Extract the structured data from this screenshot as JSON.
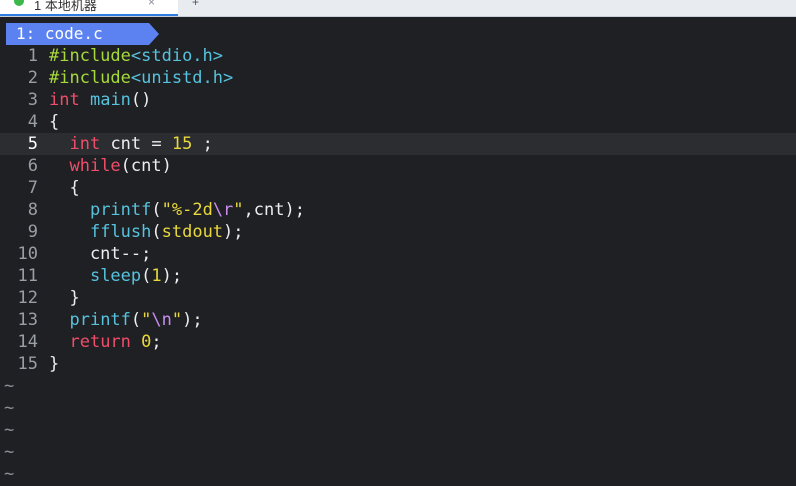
{
  "tab": {
    "label": "1 本地机器",
    "close": "×",
    "add": "+"
  },
  "buffer": {
    "label": "1: code.c"
  },
  "editor": {
    "current_line": 5,
    "lines": [
      {
        "n": "1",
        "tokens": [
          {
            "c": "pre",
            "t": "#include"
          },
          {
            "c": "inc",
            "t": "<stdio.h>"
          }
        ]
      },
      {
        "n": "2",
        "tokens": [
          {
            "c": "pre",
            "t": "#include"
          },
          {
            "c": "inc",
            "t": "<unistd.h>"
          }
        ]
      },
      {
        "n": "3",
        "tokens": [
          {
            "c": "kw",
            "t": "int"
          },
          {
            "c": "plain",
            "t": " "
          },
          {
            "c": "fn",
            "t": "main"
          },
          {
            "c": "plain",
            "t": "()"
          }
        ]
      },
      {
        "n": "4",
        "tokens": [
          {
            "c": "plain",
            "t": "{"
          }
        ]
      },
      {
        "n": "5",
        "tokens": [
          {
            "c": "plain",
            "t": "  "
          },
          {
            "c": "kw",
            "t": "int"
          },
          {
            "c": "plain",
            "t": " cnt = "
          },
          {
            "c": "num",
            "t": "15"
          },
          {
            "c": "plain",
            "t": " ;"
          }
        ]
      },
      {
        "n": "6",
        "tokens": [
          {
            "c": "plain",
            "t": "  "
          },
          {
            "c": "kw",
            "t": "while"
          },
          {
            "c": "plain",
            "t": "(cnt)"
          }
        ]
      },
      {
        "n": "7",
        "tokens": [
          {
            "c": "plain",
            "t": "  {"
          }
        ]
      },
      {
        "n": "8",
        "tokens": [
          {
            "c": "plain",
            "t": "    "
          },
          {
            "c": "fn",
            "t": "printf"
          },
          {
            "c": "plain",
            "t": "("
          },
          {
            "c": "str",
            "t": "\"%-2d"
          },
          {
            "c": "esc",
            "t": "\\r"
          },
          {
            "c": "str",
            "t": "\""
          },
          {
            "c": "plain",
            "t": ",cnt);"
          }
        ]
      },
      {
        "n": "9",
        "tokens": [
          {
            "c": "plain",
            "t": "    "
          },
          {
            "c": "fn",
            "t": "fflush"
          },
          {
            "c": "plain",
            "t": "("
          },
          {
            "c": "num",
            "t": "stdout"
          },
          {
            "c": "plain",
            "t": ");"
          }
        ]
      },
      {
        "n": "10",
        "tokens": [
          {
            "c": "plain",
            "t": "    cnt--;"
          }
        ]
      },
      {
        "n": "11",
        "tokens": [
          {
            "c": "plain",
            "t": "    "
          },
          {
            "c": "fn",
            "t": "sleep"
          },
          {
            "c": "plain",
            "t": "("
          },
          {
            "c": "num",
            "t": "1"
          },
          {
            "c": "plain",
            "t": ");"
          }
        ]
      },
      {
        "n": "12",
        "tokens": [
          {
            "c": "plain",
            "t": "  }"
          }
        ]
      },
      {
        "n": "13",
        "tokens": [
          {
            "c": "plain",
            "t": "  "
          },
          {
            "c": "fn",
            "t": "printf"
          },
          {
            "c": "plain",
            "t": "("
          },
          {
            "c": "str",
            "t": "\""
          },
          {
            "c": "esc",
            "t": "\\n"
          },
          {
            "c": "str",
            "t": "\""
          },
          {
            "c": "plain",
            "t": ");"
          }
        ]
      },
      {
        "n": "14",
        "tokens": [
          {
            "c": "plain",
            "t": "  "
          },
          {
            "c": "kw",
            "t": "return"
          },
          {
            "c": "plain",
            "t": " "
          },
          {
            "c": "num",
            "t": "0"
          },
          {
            "c": "plain",
            "t": ";"
          }
        ]
      },
      {
        "n": "15",
        "tokens": [
          {
            "c": "plain",
            "t": "}"
          }
        ]
      }
    ],
    "tilde_lines": [
      "~",
      "~",
      "~",
      "~",
      "~"
    ]
  },
  "colors": {
    "keyword": "#ef4d6a",
    "preprocessor": "#a6d93a",
    "function": "#56c2dd",
    "number": "#e8d83d",
    "buffer_tab": "#5b82f0"
  }
}
